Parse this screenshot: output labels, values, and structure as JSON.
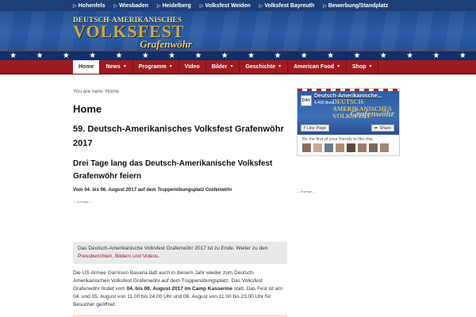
{
  "topbar": {
    "links": [
      "Hohenfels",
      "Wiesbaden",
      "Heidelberg",
      "Volksfest Weiden",
      "Volksfest Bayreuth",
      "Bewerbung/Standplatz"
    ]
  },
  "header": {
    "logo_line1": "DEUTSCH-AMERIKANISCHES",
    "logo_line2": "VOLKSFEST",
    "logo_line3": "Grafenwöhr"
  },
  "nav": {
    "home": "Home",
    "news": "News",
    "programm": "Programm",
    "video": "Video",
    "bilder": "Bilder",
    "geschichte": "Geschichte",
    "american_food": "American Food",
    "shop": "Shop"
  },
  "main": {
    "breadcrumb": "You are here: Home",
    "page_title": "Home",
    "headline": "59. Deutsch-Amerikanisches Volksfest Grafenwöhr 2017",
    "subheadline": "Drei Tage lang das Deutsch-Amerikanische Volksfest Grafenwöhr feiern",
    "date_line": "Vom 04. bis 06. August 2017 auf dem Truppenübungsplatz Grafenwöhr",
    "ad_label": "— Anzeige —",
    "notice_text": "Das Deutsch-Amerikanische Volksfest Grafenwöhr 2017 ist zu Ende. Weiter zu den",
    "notice_link": "Pressberichten, Bildern und Videos",
    "para_1": "Die US-Armee Garnison Bavaria lädt auch in diesem Jahr wieder zum Deutsch-Amerikanischen Volksfest Grafenwöhr auf dem Truppenübungsplatz. Das Volksfest Grafenwöhr findet vom",
    "para_bold": "04. bis 06. August 2017 im Camp Kasserine",
    "para_2": "statt. Das Fest ist am 04. und 05. August von 11.00 bis 24.00 Uhr und 06. August von 11.00 bis 23.00 Uhr für Besucher geöffnet."
  },
  "sidebar": {
    "fb_logo": "DAV",
    "fb_name": "Deutsch-Amerikanische...",
    "fb_likes": "4,490 likes",
    "fb_title": "DEUTSCH-AMERIKANISCHES VOLKSFEST",
    "fb_script": "Grafenwöhr",
    "like_button": "Like Page",
    "share_button": "Share",
    "friends_note": "Be the first of your friends to like this",
    "ad_label": "— Anzeige —"
  },
  "colors": {
    "nav_red": "#9e1b20",
    "top_blue": "#1d3f78",
    "link_red": "#9e1b20"
  }
}
